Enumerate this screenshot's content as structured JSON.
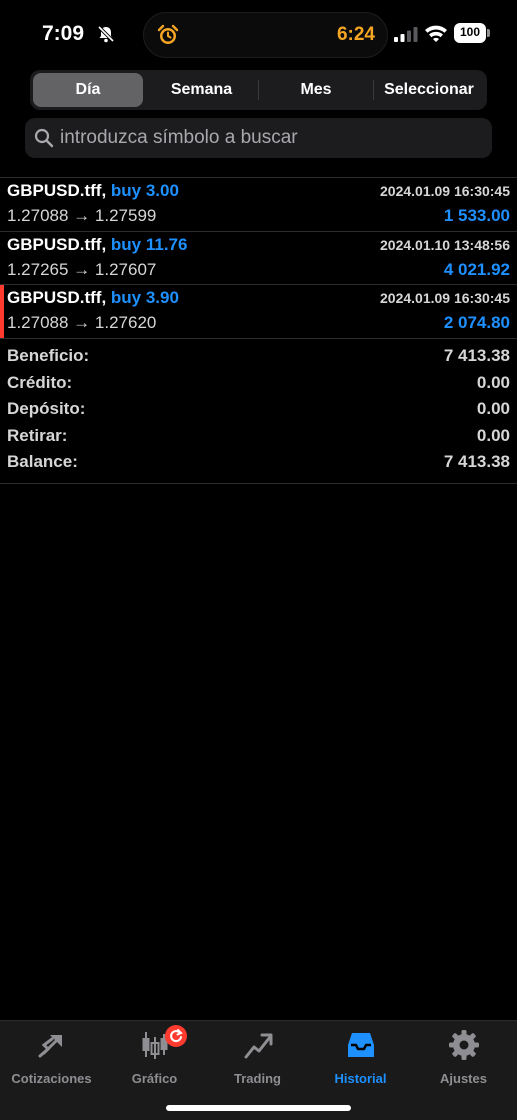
{
  "status_bar": {
    "time": "7:09",
    "island_time": "6:24",
    "battery": "100",
    "icons": [
      "mute-icon",
      "alarm-icon",
      "signal-icon",
      "wifi-icon",
      "battery-icon"
    ]
  },
  "period_tabs": [
    {
      "label": "Día",
      "active": true
    },
    {
      "label": "Semana",
      "active": false
    },
    {
      "label": "Mes",
      "active": false
    },
    {
      "label": "Seleccionar",
      "active": false
    }
  ],
  "search": {
    "placeholder": "introduzca símbolo a buscar",
    "value": ""
  },
  "trades": [
    {
      "symbol": "GBPUSD.tff,",
      "type": "buy 3.00",
      "time": "2024.01.09 16:30:45",
      "prices": "1.27088 → 1.27599",
      "profit": "1 533.00",
      "marked": false
    },
    {
      "symbol": "GBPUSD.tff,",
      "type": "buy 11.76",
      "time": "2024.01.10 13:48:56",
      "prices": "1.27265 → 1.27607",
      "profit": "4 021.92",
      "marked": false
    },
    {
      "symbol": "GBPUSD.tff,",
      "type": "buy 3.90",
      "time": "2024.01.09 16:30:45",
      "prices": "1.27088 → 1.27620",
      "profit": "2 074.80",
      "marked": true
    }
  ],
  "summary": [
    {
      "label": "Beneficio:",
      "value": "7 413.38"
    },
    {
      "label": "Crédito:",
      "value": "0.00"
    },
    {
      "label": "Depósito:",
      "value": "0.00"
    },
    {
      "label": "Retirar:",
      "value": "0.00"
    },
    {
      "label": "Balance:",
      "value": "7 413.38"
    }
  ],
  "tabbar": [
    {
      "label": "Cotizaciones",
      "icon": "quotes-icon",
      "active": false
    },
    {
      "label": "Gráfico",
      "icon": "chart-icon",
      "active": false
    },
    {
      "label": "Trading",
      "icon": "trading-icon",
      "active": false
    },
    {
      "label": "Historial",
      "icon": "history-icon",
      "active": true
    },
    {
      "label": "Ajustes",
      "icon": "settings-icon",
      "active": false
    }
  ],
  "colors": {
    "accent": "#1e90ff",
    "alarm": "#f5a623",
    "marker": "#ff3b30",
    "background": "#000000"
  }
}
